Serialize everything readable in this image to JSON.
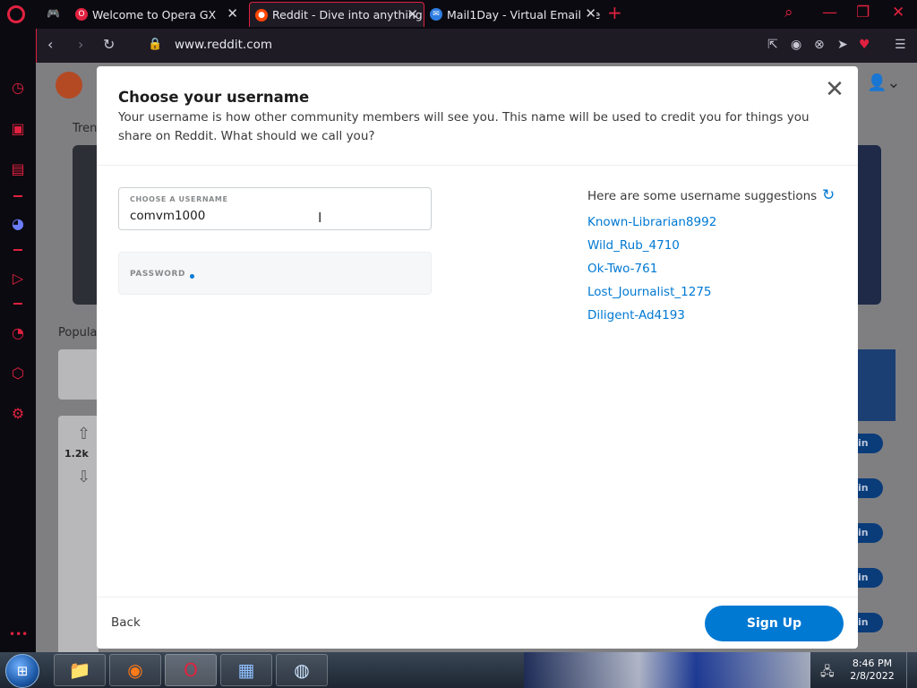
{
  "browser": {
    "tabs": [
      {
        "label": "Welcome to Opera GX"
      },
      {
        "label": "Reddit - Dive into anything"
      },
      {
        "label": "Mail1Day - Virtual Email Ge"
      }
    ],
    "url": "www.reddit.com",
    "accent": "#e0213f"
  },
  "page_behind": {
    "trending_label": "Tren",
    "popular_label": "Popula",
    "vote_count": "1.2k",
    "join_label": "in"
  },
  "modal": {
    "title": "Choose your username",
    "description": "Your username is how other community members will see you. This name will be used to credit you for things you share on Reddit. What should we call you?",
    "username_label": "CHOOSE A USERNAME",
    "username_value": "comvm1000",
    "password_label": "PASSWORD",
    "suggestions_title": "Here are some username suggestions",
    "suggestions": [
      "Known-Librarian8992",
      "Wild_Rub_4710",
      "Ok-Two-761",
      "Lost_Journalist_1275",
      "Diligent-Ad4193"
    ],
    "back_label": "Back",
    "signup_label": "Sign Up",
    "primary_color": "#0079d3"
  },
  "taskbar": {
    "time": "8:46 PM",
    "date": "2/8/2022"
  }
}
